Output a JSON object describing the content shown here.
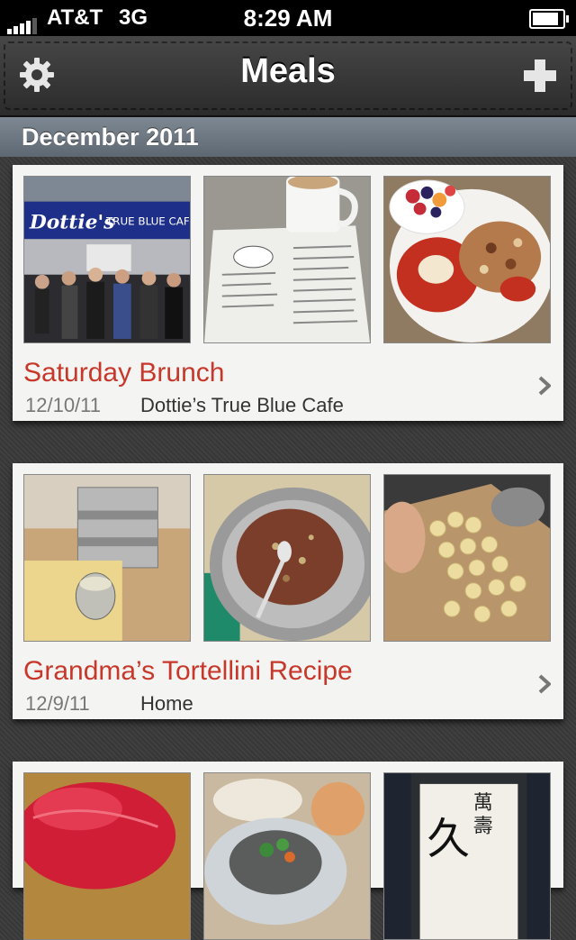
{
  "status_bar": {
    "carrier": "AT&T",
    "network": "3G",
    "time": "8:29 AM",
    "battery_level": 0.9
  },
  "nav": {
    "title": "Meals",
    "left_icon": "gear-icon",
    "right_icon": "plus-icon"
  },
  "section": {
    "title": "December 2011"
  },
  "meals": [
    {
      "title": "Saturday Brunch",
      "date": "12/10/11",
      "place": "Dottie’s True Blue Cafe",
      "photos": [
        "storefront-photo",
        "menu-coffee-photo",
        "breakfast-plate-photo"
      ]
    },
    {
      "title": "Grandma’s Tortellini Recipe",
      "date": "12/9/11",
      "place": "Home",
      "photos": [
        "pasta-machine-photo",
        "filling-bowl-photo",
        "tortellini-tray-photo"
      ]
    },
    {
      "title": "",
      "date": "",
      "place": "",
      "photos": [
        "tuna-sashimi-photo",
        "oyster-photo",
        "sake-bottle-photo"
      ]
    }
  ],
  "colors": {
    "accent_red": "#c7382b",
    "section_header": "#6f7a85"
  }
}
